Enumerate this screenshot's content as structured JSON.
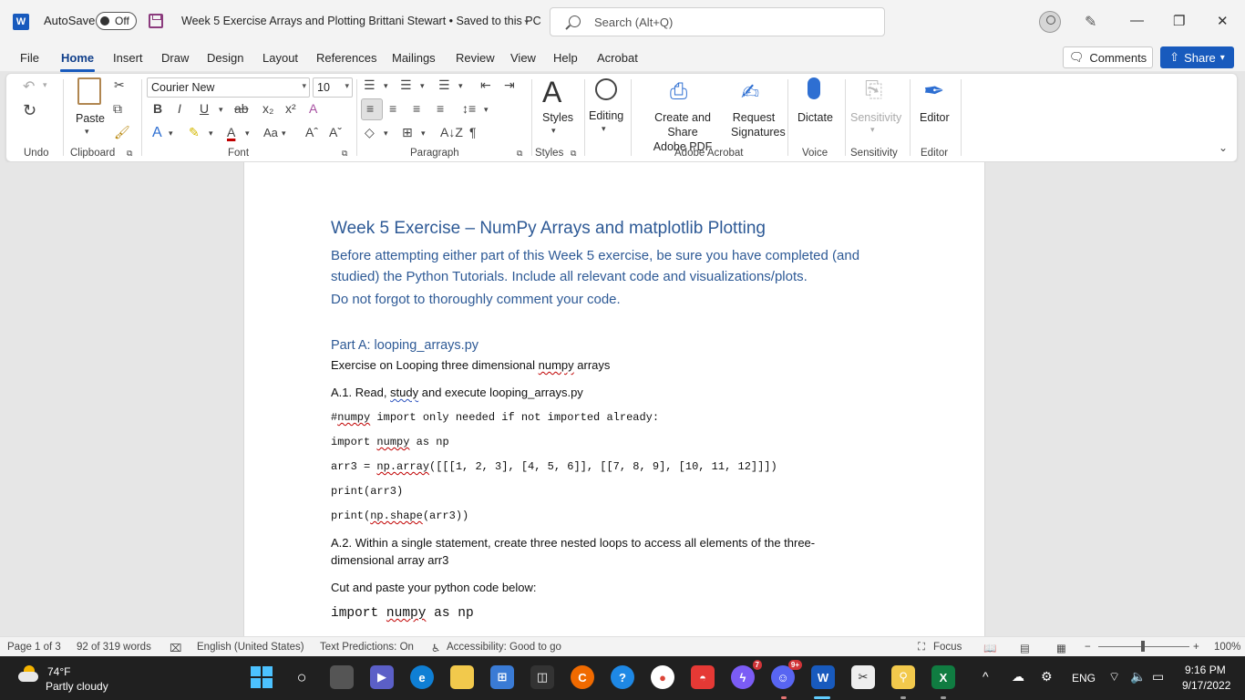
{
  "window": {
    "autosave_label": "AutoSave",
    "autosave_state": "Off",
    "doc_title": "Week 5 Exercise Arrays and Plotting Brittani Stewart • Saved to this PC",
    "search_placeholder": "Search (Alt+Q)"
  },
  "menu": {
    "tabs": [
      "File",
      "Home",
      "Insert",
      "Draw",
      "Design",
      "Layout",
      "References",
      "Mailings",
      "Review",
      "View",
      "Help",
      "Acrobat"
    ],
    "active_tab": "Home",
    "comments_label": "Comments",
    "share_label": "Share"
  },
  "ribbon": {
    "font_name": "Courier New",
    "font_size": "10",
    "paste_label": "Paste",
    "styles_label": "Styles",
    "editing_label": "Editing",
    "create_share_label": "Create and Share\nAdobe PDF",
    "request_sig_label": "Request\nSignatures",
    "dictate_label": "Dictate",
    "sensitivity_label": "Sensitivity",
    "editor_label": "Editor",
    "groups": {
      "undo": "Undo",
      "clipboard": "Clipboard",
      "font": "Font",
      "paragraph": "Paragraph",
      "styles": "Styles",
      "adobe": "Adobe Acrobat",
      "voice": "Voice",
      "sensitivity": "Sensitivity",
      "editor": "Editor"
    }
  },
  "document": {
    "title": "Week 5 Exercise – NumPy Arrays and matplotlib Plotting",
    "intro_line1": "Before attempting either part of this Week 5 exercise, be sure you have completed (and",
    "intro_line2": "studied) the Python Tutorials.  Include all relevant code and visualizations/plots.",
    "intro_line3": "Do not forgot to thoroughly comment your code.",
    "part_a_heading": "Part A: looping_arrays.py",
    "part_a_desc_pre": "Exercise on Looping three dimensional ",
    "part_a_desc_word": "numpy",
    "part_a_desc_post": " arrays",
    "a1_pre": "A.1. Read, ",
    "a1_word": "study",
    "a1_post": " and execute looping_arrays.py",
    "code1_hash": "#",
    "code1_word": "numpy",
    "code1_post": " import only needed if not imported already:",
    "code2_pre": "import ",
    "code2_word": "numpy",
    "code2_post": " as np",
    "code3_pre": "arr3 = ",
    "code3_word": "np.array",
    "code3_post": "([[[1, 2, 3], [4, 5, 6]], [[7, 8, 9], [10, 11, 12]]])",
    "code4": "print(arr3)",
    "code5_pre": "print(",
    "code5_word": "np.shape",
    "code5_post": "(arr3))",
    "a2_line1": "A.2. Within a single statement, create three nested loops to access all elements of the three-",
    "a2_line2": "dimensional array arr3",
    "cut_paste": "Cut and paste your python code below:",
    "code6_pre": "import ",
    "code6_word": "numpy",
    "code6_post": " as np"
  },
  "status": {
    "page": "Page 1 of 3",
    "words": "92 of 319 words",
    "language": "English (United States)",
    "predictions": "Text Predictions: On",
    "accessibility": "Accessibility: Good to go",
    "focus": "Focus",
    "zoom": "100%"
  },
  "taskbar": {
    "temperature": "74°F",
    "weather": "Partly cloudy",
    "language": "ENG",
    "time": "9:16 PM",
    "date": "9/17/2022",
    "discord_badge": "9+",
    "messenger_badge": "7"
  }
}
